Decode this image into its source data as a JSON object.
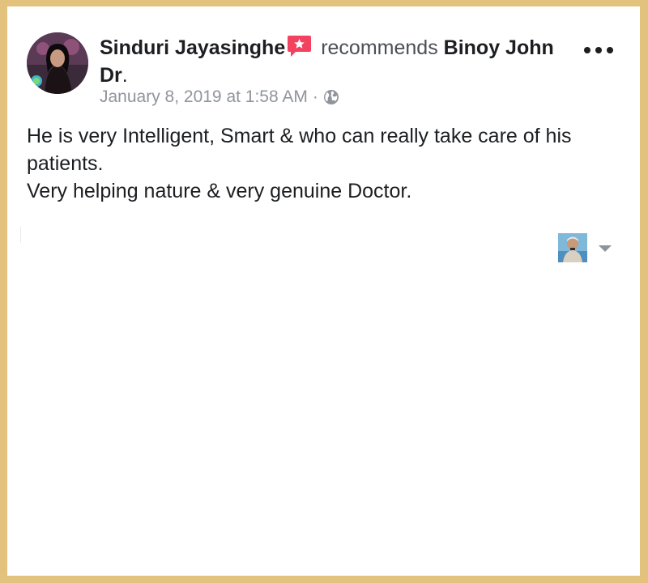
{
  "post": {
    "author": "Sinduri Jayasinghe",
    "verb": "recommends",
    "target": "Binoy John Dr",
    "target_suffix": ".",
    "timestamp": "January 8, 2019 at 1:58 AM",
    "separator": "·",
    "privacy_icon": "globe-icon",
    "recommend_icon": "recommendation-star-icon",
    "more_icon": "more-options-icon",
    "body_lines": [
      "He is very Intelligent, Smart & who can really take care of his patients.",
      "Very helping nature & very genuine Doctor."
    ]
  },
  "footer": {
    "page_icon": "page-profile-thumbnail",
    "dropdown_icon": "caret-down-icon"
  },
  "colors": {
    "frame": "#e2c27c",
    "card": "#ffffff",
    "text": "#1c1e21",
    "meta": "#90949c",
    "recommend_badge": "#f3425f"
  }
}
